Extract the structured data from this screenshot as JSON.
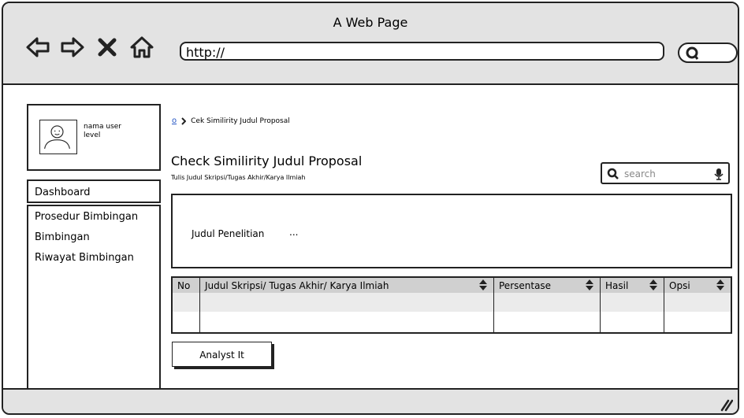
{
  "window": {
    "title": "A Web Page"
  },
  "browser": {
    "url": "http://",
    "nav_icons": [
      "back-arrow-icon",
      "forward-arrow-icon",
      "close-x-icon",
      "home-icon"
    ]
  },
  "sidebar": {
    "user": {
      "name": "nama user",
      "level": "level"
    },
    "dashboard": "Dashboard",
    "items": [
      {
        "label": "Prosedur Bimbingan"
      },
      {
        "label": "Bimbingan"
      },
      {
        "label": "Riwayat Bimbingan"
      }
    ]
  },
  "breadcrumb": {
    "home": "o",
    "current": "Cek Similirity Judul Proposal"
  },
  "page": {
    "title": "Check Similirity Judul Proposal",
    "subtitle": "Tulis Judul Skripsi/Tugas Akhir/Karya Ilmiah"
  },
  "search": {
    "placeholder": "search"
  },
  "form": {
    "label": "Judul Penelitian",
    "value": "..."
  },
  "table": {
    "headers": [
      "No",
      "Judul Skripsi/ Tugas Akhir/ Karya Ilmiah",
      "Persentase",
      "Hasil",
      "Opsi"
    ]
  },
  "actions": {
    "analyze": "Analyst It"
  }
}
